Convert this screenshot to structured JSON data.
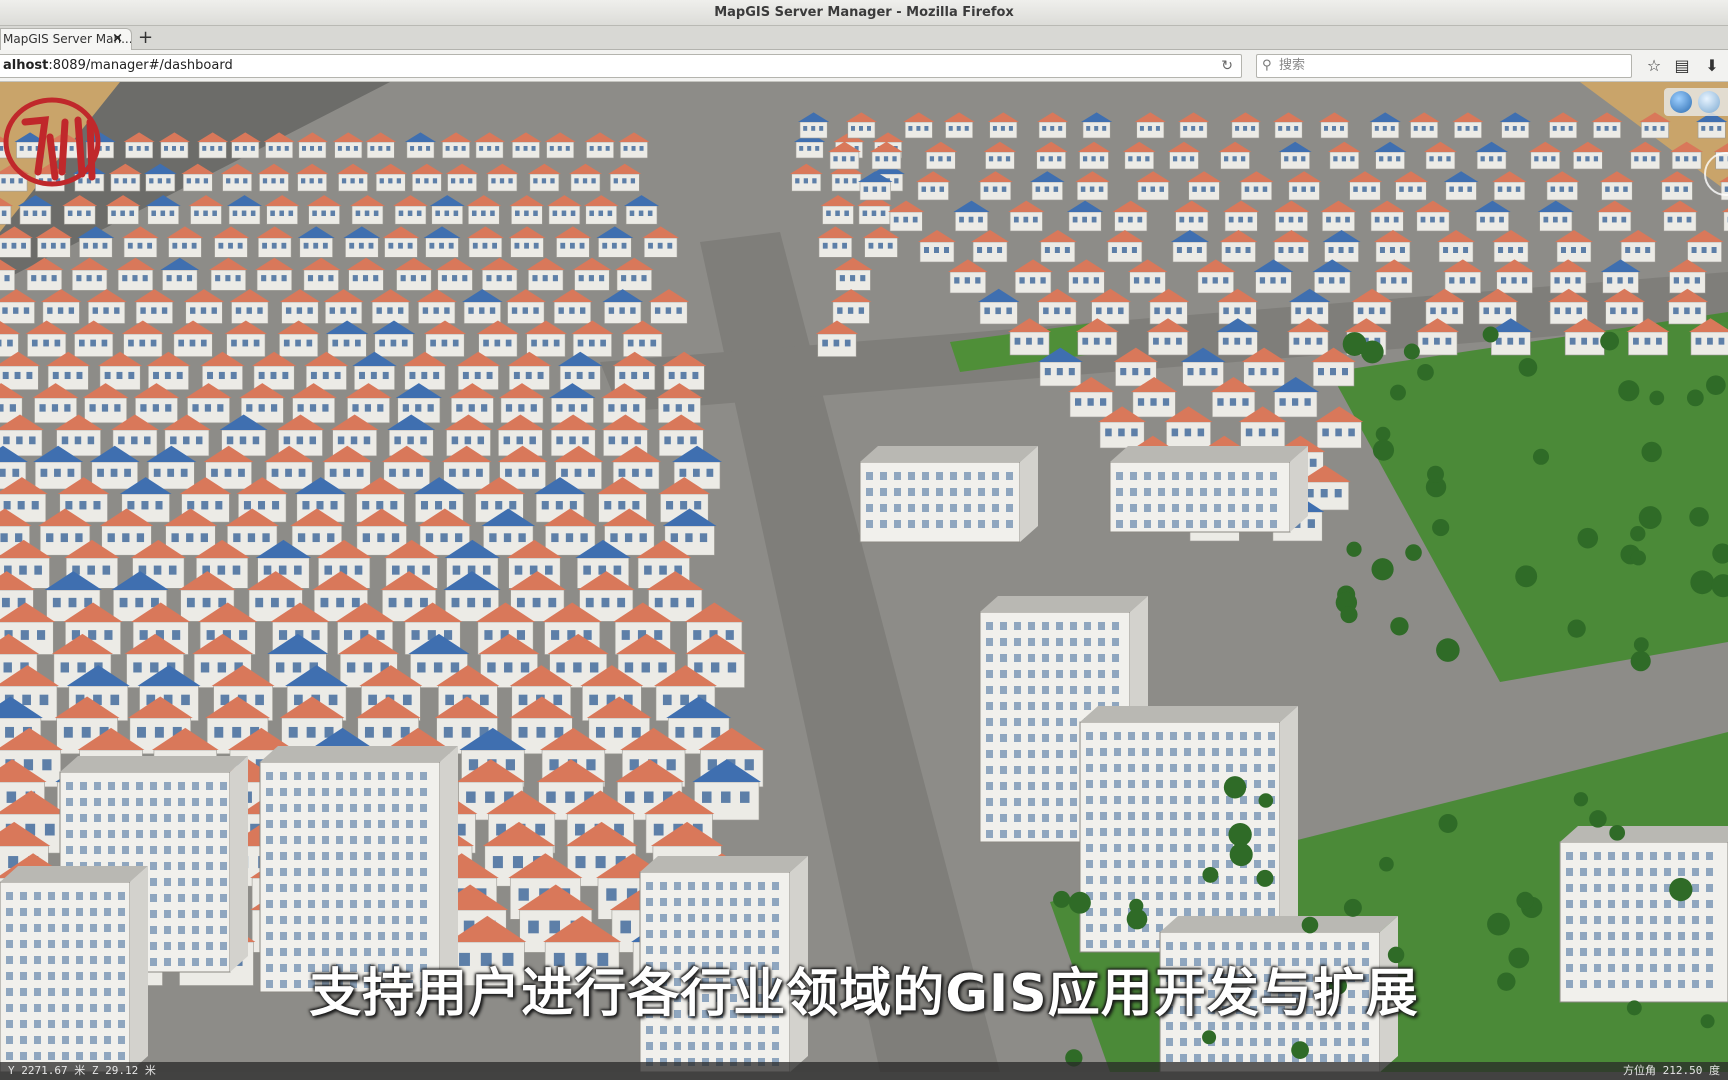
{
  "window": {
    "title": "MapGIS Server Manager - Mozilla Firefox"
  },
  "tab": {
    "label": "MapGIS Server Man...",
    "close": "×",
    "new_tab": "+"
  },
  "navbar": {
    "url_host": "alhost",
    "url_port": ":8089",
    "url_path": "/manager#/dashboard",
    "search_placeholder": "搜索"
  },
  "scene": {
    "caption": "支持用户进行各行业领域的GIS应用开发与扩展",
    "logo_text": "九州"
  },
  "status": {
    "y_label": "Y",
    "y_value": "2271.67",
    "y_unit": "米",
    "z_label": "Z",
    "z_value": "29.12",
    "z_unit": "米",
    "heading_label": "方位角",
    "heading_value": "212.50",
    "heading_unit": "度"
  },
  "colors": {
    "roof_red": "#d9785a",
    "roof_blue": "#3f6fb0",
    "facade": "#ecebe6",
    "road": "#8d8c88",
    "grass": "#3f8a2a",
    "tree": "#2f6b27",
    "sand": "#c9a46a",
    "logo_red": "#c0282b"
  }
}
